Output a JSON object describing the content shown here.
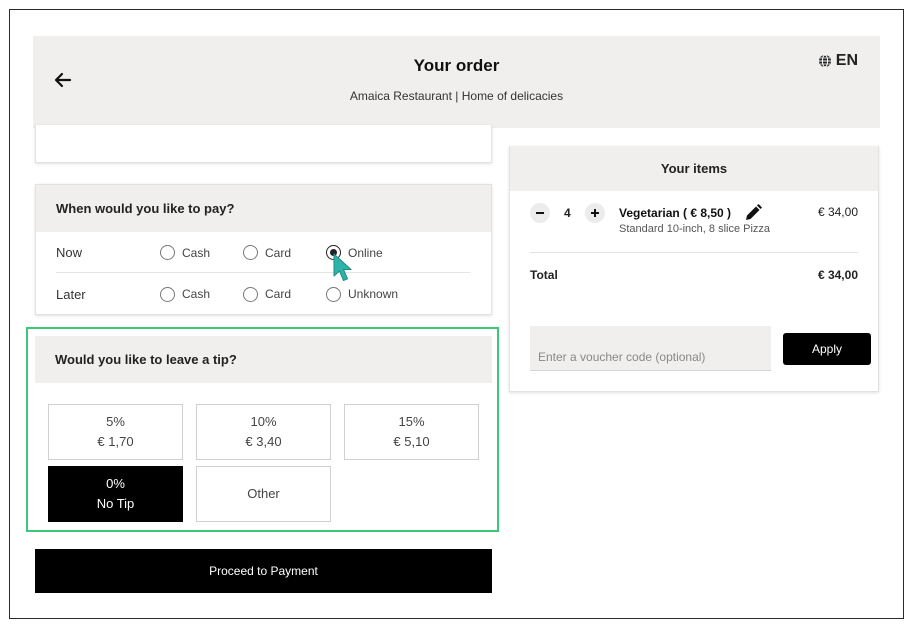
{
  "header": {
    "title": "Your order",
    "subtitle": "Amaica Restaurant | Home of delicacies",
    "language": "EN"
  },
  "payment": {
    "heading": "When would you like to pay?",
    "rows": [
      {
        "label": "Now",
        "options": [
          "Cash",
          "Card",
          "Online"
        ],
        "selected": "Online"
      },
      {
        "label": "Later",
        "options": [
          "Cash",
          "Card",
          "Unknown"
        ],
        "selected": null
      }
    ]
  },
  "tip": {
    "heading": "Would you like to leave a tip?",
    "options": [
      {
        "percent": "5%",
        "amount": "€ 1,70"
      },
      {
        "percent": "10%",
        "amount": "€ 3,40"
      },
      {
        "percent": "15%",
        "amount": "€ 5,10"
      },
      {
        "percent": "0%",
        "amount": "No Tip",
        "selected": true
      },
      {
        "label": "Other"
      }
    ]
  },
  "proceed_label": "Proceed to Payment",
  "items": {
    "heading": "Your items",
    "list": [
      {
        "quantity": "4",
        "name": "Vegetarian ( € 8,50 )",
        "description": "Standard 10-inch, 8 slice Pizza",
        "price": "€ 34,00"
      }
    ],
    "total_label": "Total",
    "total_value": "€ 34,00"
  },
  "voucher": {
    "placeholder": "Enter a voucher code (optional)",
    "value": "",
    "apply_label": "Apply"
  },
  "colors": {
    "header_bg": "#f1efed",
    "accent_outline": "#3cc67a",
    "primary_button": "#000000",
    "cursor": "#2fb3a9"
  },
  "icons": {
    "back": "arrow-left-icon",
    "language": "globe-icon",
    "edit": "pencil-icon",
    "minus": "minus-icon",
    "plus": "plus-icon",
    "cursor": "hand-pointer-icon"
  }
}
